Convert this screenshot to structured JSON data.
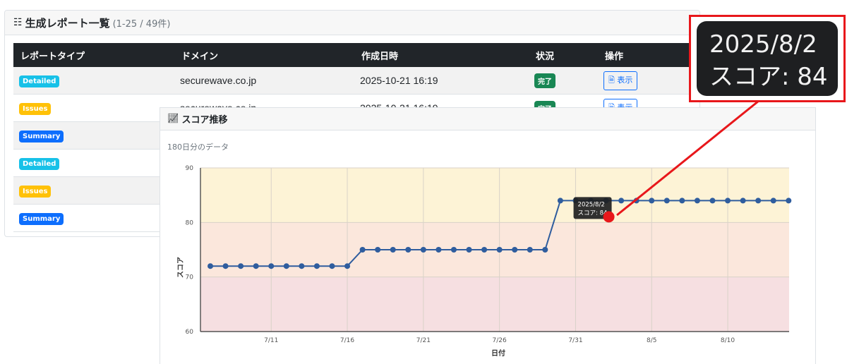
{
  "report_list": {
    "title": "生成レポート一覧",
    "count": "(1-25 / 49件)",
    "columns": [
      "レポートタイプ",
      "ドメイン",
      "作成日時",
      "状況",
      "操作"
    ],
    "rows": [
      {
        "type": "Detailed",
        "domain": "securewave.co.jp",
        "created": "2025-10-21 16:19",
        "status": "完了",
        "action": "表示"
      },
      {
        "type": "Issues",
        "domain": "securewave.co.jp",
        "created": "2025-10-21 16:19",
        "status": "完了",
        "action": "表示"
      },
      {
        "type": "Summary",
        "domain": "",
        "created": "",
        "status": "",
        "action": ""
      },
      {
        "type": "Detailed",
        "domain": "",
        "created": "",
        "status": "",
        "action": ""
      },
      {
        "type": "Issues",
        "domain": "",
        "created": "",
        "status": "",
        "action": ""
      },
      {
        "type": "Summary",
        "domain": "",
        "created": "",
        "status": "",
        "action": ""
      }
    ]
  },
  "score_card": {
    "title": "スコア推移",
    "range_note": "180日分のデータ"
  },
  "tooltip": {
    "date": "2025/8/2",
    "score_text": "スコア: 84"
  },
  "zoom": {
    "line1": "2025/8/2",
    "line2": "スコア: 84"
  },
  "colors": {
    "line": "#2f5d9e",
    "band_high": "#fdf3d6",
    "band_mid": "#fbe7dc",
    "band_low": "#f6dfe1",
    "highlight": "#e8171b"
  },
  "chart_data": {
    "type": "line",
    "xlabel": "日付",
    "ylabel": "スコア",
    "ylim": [
      60,
      90
    ],
    "yticks": [
      60,
      70,
      80,
      90
    ],
    "xticks": [
      "7/11",
      "7/16",
      "7/21",
      "7/26",
      "7/31",
      "8/5",
      "8/10"
    ],
    "x": [
      "7/7",
      "7/8",
      "7/9",
      "7/10",
      "7/11",
      "7/12",
      "7/13",
      "7/14",
      "7/15",
      "7/16",
      "7/17",
      "7/18",
      "7/19",
      "7/20",
      "7/21",
      "7/22",
      "7/23",
      "7/24",
      "7/25",
      "7/26",
      "7/27",
      "7/28",
      "7/29",
      "7/30",
      "7/31",
      "8/1",
      "8/2",
      "8/3",
      "8/4",
      "8/5",
      "8/6",
      "8/7",
      "8/8",
      "8/9",
      "8/10",
      "8/11",
      "8/12",
      "8/13",
      "8/14"
    ],
    "series": [
      {
        "values": [
          72,
          72,
          72,
          72,
          72,
          72,
          72,
          72,
          72,
          72,
          75,
          75,
          75,
          75,
          75,
          75,
          75,
          75,
          75,
          75,
          75,
          75,
          75,
          84,
          84,
          84,
          84,
          84,
          84,
          84,
          84,
          84,
          84,
          84,
          84,
          84,
          84,
          84,
          84
        ]
      }
    ],
    "bands": [
      {
        "from": 80,
        "to": 90
      },
      {
        "from": 70,
        "to": 80
      },
      {
        "from": 60,
        "to": 70
      }
    ],
    "highlighted_point": {
      "x": "8/2",
      "y": 84
    },
    "grid": true
  }
}
